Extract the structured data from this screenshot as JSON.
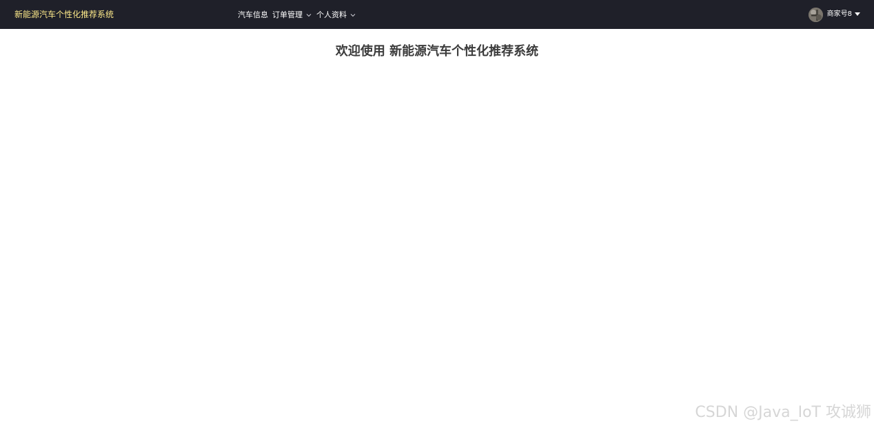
{
  "header": {
    "brand": "新能源汽车个性化推荐系统",
    "nav": [
      {
        "label": "汽车信息",
        "has_dropdown": false
      },
      {
        "label": "订单管理",
        "has_dropdown": true
      },
      {
        "label": "个人资料",
        "has_dropdown": true
      }
    ],
    "user": {
      "name": "商家号8",
      "icon": "caret-down-icon"
    }
  },
  "main": {
    "welcome": "欢迎使用 新能源汽车个性化推荐系统"
  },
  "watermark": "CSDN @Java_IoT 攻诚狮",
  "colors": {
    "header_bg": "#1f2029",
    "brand": "#fde98a",
    "nav_text": "#ffffff",
    "title_text": "#3b3b3b"
  }
}
